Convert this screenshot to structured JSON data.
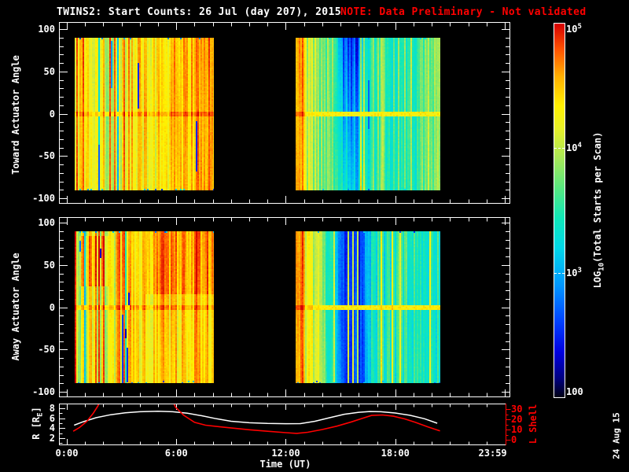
{
  "window": {
    "background": "#000000",
    "foreground": "#ffffff",
    "accent_red": "#ff0000"
  },
  "chart_data": {
    "type": "heatmap",
    "title": "TWINS2: Start Counts: 26 Jul (day 207), 2015",
    "note": "NOTE: Data Preliminary - Not validated",
    "note_color": "#ff0000",
    "xlabel": "Time (UT)",
    "x_hours_range": [
      0,
      23.983
    ],
    "xticks": [
      {
        "hour": 0,
        "label": "0:00"
      },
      {
        "hour": 6,
        "label": "6:00"
      },
      {
        "hour": 12,
        "label": "12:00"
      },
      {
        "hour": 18,
        "label": "18:00"
      },
      {
        "hour": 23.983,
        "label": "23:59"
      }
    ],
    "grid": false,
    "legend_position": "none",
    "date_stamp": "24 Aug 15",
    "colorbar": {
      "label": "LOG_{10}(Total Starts per Scan)",
      "log10_range": [
        2,
        5
      ],
      "ticks": [
        {
          "value": 5,
          "label": "10^{5}"
        },
        {
          "value": 4,
          "label": "10^{4}"
        },
        {
          "value": 3,
          "label": "10^{3}"
        },
        {
          "value": 2,
          "label": "100"
        }
      ],
      "colormap_stops": [
        {
          "t": 0.0,
          "c": "#000014"
        },
        {
          "t": 0.05,
          "c": "#000080"
        },
        {
          "t": 0.12,
          "c": "#0000e0"
        },
        {
          "t": 0.2,
          "c": "#0040ff"
        },
        {
          "t": 0.3,
          "c": "#0098ff"
        },
        {
          "t": 0.4,
          "c": "#00d8e8"
        },
        {
          "t": 0.48,
          "c": "#10e8b8"
        },
        {
          "t": 0.56,
          "c": "#58e880"
        },
        {
          "t": 0.64,
          "c": "#a8e858"
        },
        {
          "t": 0.72,
          "c": "#e8f028"
        },
        {
          "t": 0.78,
          "c": "#fff000"
        },
        {
          "t": 0.86,
          "c": "#ffae00"
        },
        {
          "t": 0.93,
          "c": "#ff5400"
        },
        {
          "t": 1.0,
          "c": "#d60000"
        }
      ]
    },
    "panels": [
      {
        "name": "toward",
        "ylabel": "Toward Actuator Angle",
        "yrange": [
          -100,
          100
        ],
        "ytick_major": [
          100,
          50,
          0,
          -50,
          -100
        ],
        "ytick_minor_step": 10,
        "blocks": [
          {
            "seed": 101,
            "t0": 0.43,
            "t1": 8.06,
            "profile": [
              [
                0.43,
                4.5
              ],
              [
                0.8,
                4.3
              ],
              [
                1.3,
                4.2
              ],
              [
                2.0,
                4.3
              ],
              [
                2.8,
                4.25
              ],
              [
                3.6,
                4.35
              ],
              [
                4.6,
                4.3
              ],
              [
                5.6,
                4.4
              ],
              [
                6.6,
                4.5
              ],
              [
                7.3,
                4.6
              ],
              [
                8.06,
                4.55
              ]
            ],
            "noise": 0.27,
            "chaos_end": 3.3,
            "chaos_mult": 1.8,
            "cold_prob": 0.07,
            "fleck_prob": 0.03,
            "fleck_prob_chaos": 0.14,
            "spike_prob": 0.05,
            "spike_level": [
              4.6,
              4.85
            ],
            "smooth_after": 7.2,
            "zero_stripe": true
          },
          {
            "seed": 202,
            "t0": 12.54,
            "t1": 20.47,
            "profile": [
              [
                12.54,
                4.65
              ],
              [
                12.95,
                4.6
              ],
              [
                13.15,
                4.05
              ],
              [
                13.7,
                3.9
              ],
              [
                14.3,
                3.75
              ],
              [
                14.9,
                3.5
              ],
              [
                15.3,
                3.05
              ],
              [
                15.75,
                2.9
              ],
              [
                16.2,
                3.2
              ],
              [
                16.7,
                3.55
              ],
              [
                17.3,
                3.7
              ],
              [
                18.0,
                3.55
              ],
              [
                18.7,
                3.7
              ],
              [
                19.3,
                3.55
              ],
              [
                19.9,
                3.8
              ],
              [
                20.47,
                3.7
              ]
            ],
            "noise": 0.3,
            "fleck_prob": 0.02,
            "spike_prob": 0.07,
            "spike_level": [
              3.95,
              4.4
            ],
            "hot_lead": 0.45,
            "dip": {
              "t0": 14.7,
              "t1": 16.5,
              "top": -0.45,
              "bottom": 0.2
            },
            "zero_stripe": true
          }
        ]
      },
      {
        "name": "away",
        "ylabel": "Away Actuator Angle",
        "yrange": [
          -100,
          100
        ],
        "ytick_major": [
          100,
          50,
          0,
          -50,
          -100
        ],
        "ytick_minor_step": 10,
        "blocks": [
          {
            "seed": 303,
            "t0": 0.43,
            "t1": 8.06,
            "profile": [
              [
                0.43,
                4.45
              ],
              [
                1.0,
                4.3
              ],
              [
                1.8,
                4.3
              ],
              [
                2.6,
                4.25
              ],
              [
                3.4,
                4.3
              ],
              [
                4.4,
                4.35
              ],
              [
                5.4,
                4.4
              ],
              [
                6.4,
                4.45
              ],
              [
                7.2,
                4.5
              ],
              [
                8.06,
                4.5
              ]
            ],
            "noise": 0.3,
            "chaos_end": 3.5,
            "chaos_mult": 1.9,
            "cold_prob": 0.08,
            "fleck_prob": 0.03,
            "fleck_prob_chaos": 0.16,
            "spike_prob": 0.04,
            "spike_level": [
              4.6,
              4.8
            ],
            "blobs": [
              {
                "t0": 0.7,
                "t1": 2.3,
                "d0": 25,
                "d1": 85,
                "boost": 0.25
              },
              {
                "t0": 4.3,
                "t1": 8.06,
                "d0": 15,
                "d1": 90,
                "boost": 0.2
              }
            ],
            "zero_stripe": true
          },
          {
            "seed": 404,
            "t0": 12.54,
            "t1": 20.47,
            "profile": [
              [
                12.54,
                4.7
              ],
              [
                12.9,
                4.65
              ],
              [
                13.2,
                4.15
              ],
              [
                13.8,
                3.95
              ],
              [
                14.4,
                3.5
              ],
              [
                14.9,
                3.05
              ],
              [
                15.4,
                2.8
              ],
              [
                15.95,
                2.8
              ],
              [
                16.45,
                3.15
              ],
              [
                17.0,
                3.45
              ],
              [
                17.6,
                3.4
              ],
              [
                18.2,
                3.5
              ],
              [
                18.9,
                3.4
              ],
              [
                19.5,
                3.55
              ],
              [
                20.0,
                3.45
              ],
              [
                20.47,
                3.4
              ]
            ],
            "noise": 0.27,
            "fleck_prob": 0.02,
            "spike_prob": 0.08,
            "spike_level": [
              3.95,
              4.35
            ],
            "hot_lead": 0.5,
            "dip": {
              "t0": 14.5,
              "t1": 16.6,
              "top": -0.2,
              "bottom": -0.15
            },
            "zero_stripe": true
          }
        ]
      }
    ],
    "ephemeris": {
      "left_label": "R [R_{E}]",
      "left_ticks": [
        8,
        6,
        4,
        2
      ],
      "left_range": [
        0.7,
        9.0
      ],
      "right_label": "L Shell",
      "right_ticks": [
        30,
        20,
        10,
        0
      ],
      "right_range": [
        0,
        34
      ],
      "right_color": "#ff0000",
      "series": [
        {
          "name": "R",
          "color": "#ffffff",
          "points": [
            [
              0.4,
              4.6
            ],
            [
              0.9,
              5.3
            ],
            [
              1.6,
              6.1
            ],
            [
              2.4,
              6.7
            ],
            [
              3.2,
              7.1
            ],
            [
              4.0,
              7.3
            ],
            [
              5.0,
              7.4
            ],
            [
              5.8,
              7.3
            ],
            [
              6.6,
              7.0
            ],
            [
              7.4,
              6.5
            ],
            [
              8.2,
              5.9
            ],
            [
              9.0,
              5.4
            ],
            [
              10.0,
              5.1
            ],
            [
              11.0,
              4.95
            ],
            [
              12.0,
              4.9
            ],
            [
              12.8,
              4.92
            ],
            [
              13.6,
              5.4
            ],
            [
              14.4,
              6.1
            ],
            [
              15.2,
              6.8
            ],
            [
              16.0,
              7.2
            ],
            [
              16.6,
              7.35
            ],
            [
              17.2,
              7.3
            ],
            [
              18.0,
              7.05
            ],
            [
              18.8,
              6.6
            ],
            [
              19.6,
              5.9
            ],
            [
              20.3,
              5.0
            ]
          ]
        },
        {
          "name": "L Shell",
          "color": "#ff0000",
          "points": [
            [
              0.35,
              8.3
            ],
            [
              0.7,
              12
            ],
            [
              1.1,
              18
            ],
            [
              1.45,
              26
            ],
            [
              1.7,
              33
            ],
            [
              2.3,
              60
            ],
            [
              3.6,
              85
            ],
            [
              5.3,
              60
            ],
            [
              5.95,
              32
            ],
            [
              6.4,
              24
            ],
            [
              7.0,
              17
            ],
            [
              7.6,
              14.2
            ],
            [
              8.4,
              12.6
            ],
            [
              9.2,
              11.2
            ],
            [
              10.0,
              9.8
            ],
            [
              11.0,
              8.3
            ],
            [
              12.0,
              6.9
            ],
            [
              12.6,
              6.2
            ],
            [
              13.2,
              7.3
            ],
            [
              14.0,
              10
            ],
            [
              14.8,
              13.3
            ],
            [
              15.6,
              17.5
            ],
            [
              16.2,
              21
            ],
            [
              16.7,
              23.8
            ],
            [
              17.3,
              24.2
            ],
            [
              17.9,
              23
            ],
            [
              18.5,
              20.5
            ],
            [
              19.1,
              17
            ],
            [
              19.8,
              12.5
            ],
            [
              20.45,
              8.6
            ]
          ]
        }
      ]
    }
  }
}
